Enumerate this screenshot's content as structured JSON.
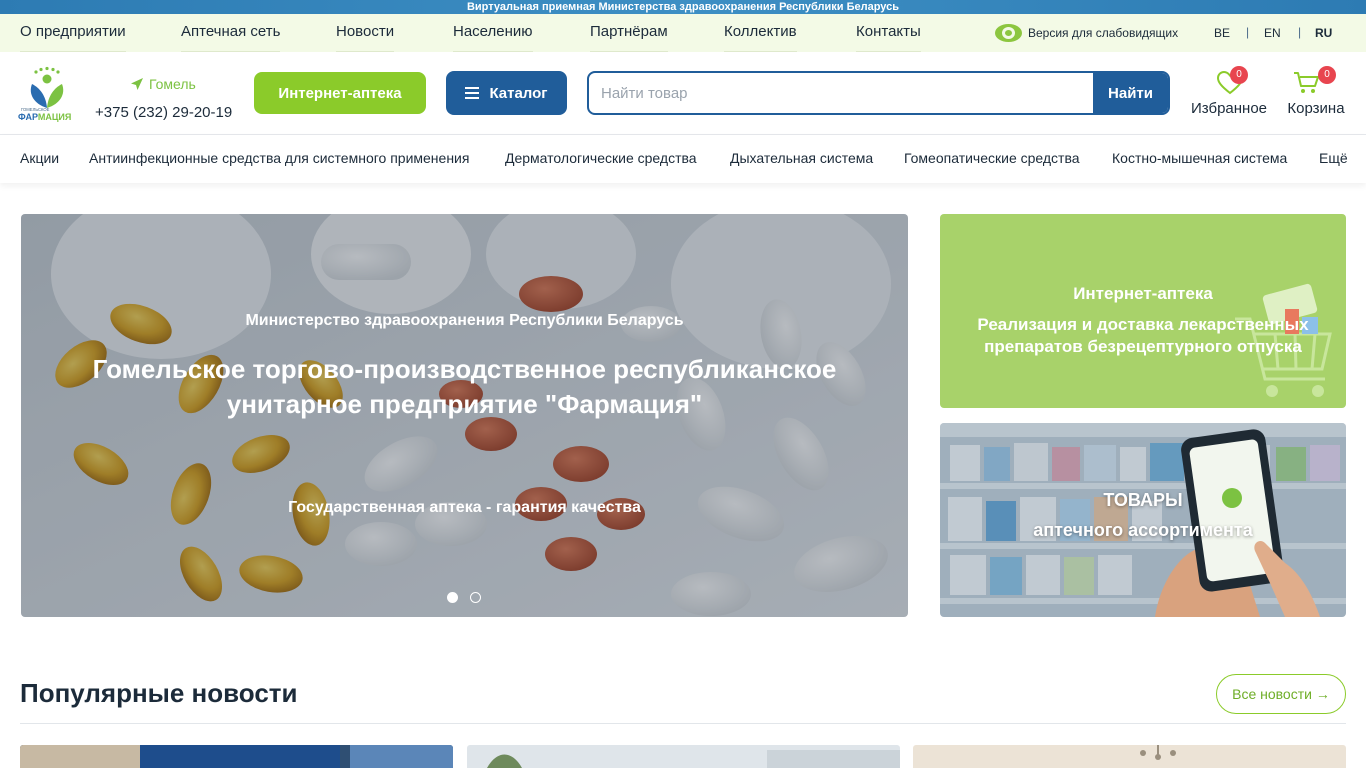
{
  "banner": {
    "text": "Виртуальная приемная Министерства здравоохранения Республики Беларусь"
  },
  "topnav": {
    "items": [
      "О предприятии",
      "Аптечная сеть",
      "Новости",
      "Населению",
      "Партнёрам",
      "Коллектив",
      "Контакты"
    ],
    "vision_label": "Версия для слабовидящих",
    "languages": [
      "BE",
      "EN",
      "RU"
    ],
    "active_language": "RU"
  },
  "header": {
    "logo_text_small": "ГОМЕЛЬСКОЕ",
    "logo_text_big": "ФАРМАЦИЯ",
    "city": "Гомель",
    "phone": "+375 (232) 29-20-19",
    "pharmacy_button": "Интернет-аптека",
    "catalog_button": "Каталог",
    "search_placeholder": "Найти товар",
    "search_button": "Найти",
    "favorites": {
      "label": "Избранное",
      "count": "0"
    },
    "cart": {
      "label": "Корзина",
      "count": "0"
    }
  },
  "categories": [
    "Акции",
    "Антиинфекционные средства для системного применения",
    "Дерматологические средства",
    "Дыхательная система",
    "Гомеопатические средства",
    "Костно-мышечная система",
    "Ещё"
  ],
  "hero": {
    "subtitle": "Министерство здравоохранения Республики Беларусь",
    "title": "Гомельское торгово-производственное республиканское унитарное предприятие \"Фармация\"",
    "tagline": "Государственная аптека - гарантия качества",
    "slides": 2,
    "active_slide": 1
  },
  "cards": {
    "pharmacy": {
      "title": "Интернет-аптека",
      "desc": "Реализация и доставка лекарственных препаратов безрецептурного отпуска"
    },
    "goods": {
      "title": "ТОВАРЫ",
      "desc": "аптечного ассортимента"
    }
  },
  "news": {
    "title": "Популярные новости",
    "all_button": "Все новости →"
  },
  "colors": {
    "brand_blue": "#205d9a",
    "brand_green": "#8bcb2a",
    "badge_red": "#e8454f",
    "topnav_bg": "#f3fae6"
  }
}
